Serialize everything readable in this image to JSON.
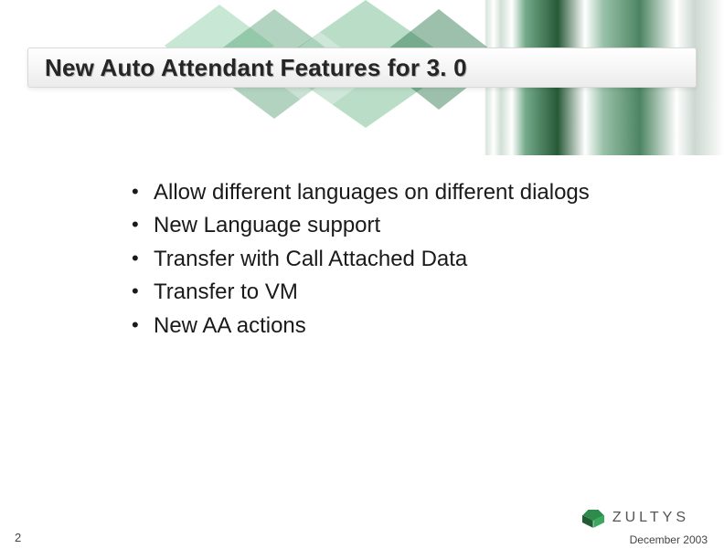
{
  "title": "New Auto Attendant Features for 3. 0",
  "bullets": [
    "Allow different languages on different dialogs",
    "New Language support",
    "Transfer with Call Attached Data",
    "Transfer to VM",
    "New AA actions"
  ],
  "page_number": "2",
  "footer_date": "December 2003",
  "logo_text": "ZULTYS"
}
